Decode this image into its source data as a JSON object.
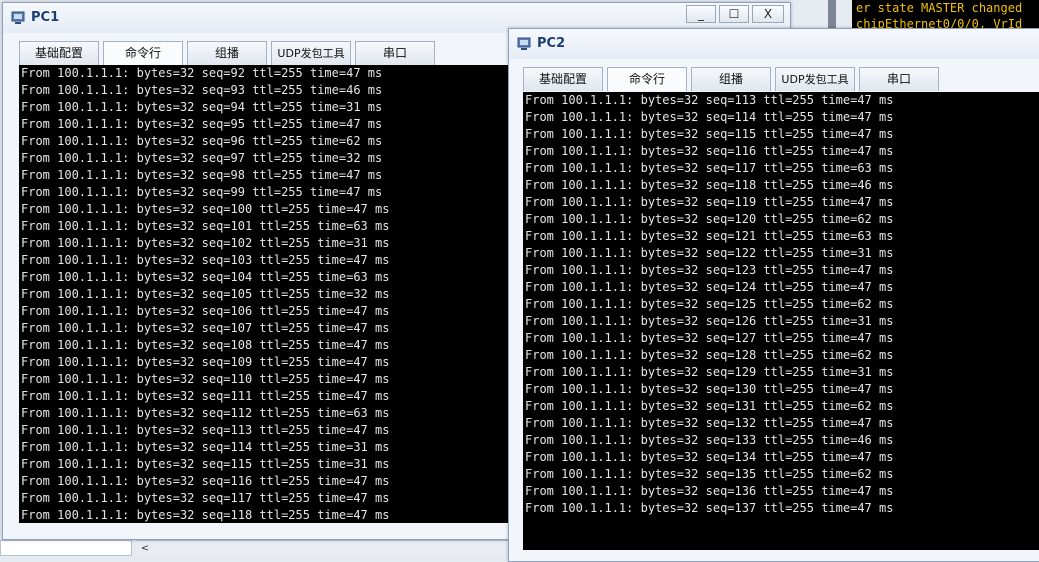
{
  "background": {
    "console_lines": [
      "er state MASTER changed",
      "chipEthernet0/0/0, VrId"
    ]
  },
  "pc1": {
    "title": "PC1",
    "controls": {
      "minimize": "_",
      "maximize": "☐",
      "close": "X"
    },
    "tabs": [
      "基础配置",
      "命令行",
      "组播",
      "UDP发包工具",
      "串口"
    ],
    "active_tab": "命令行",
    "lines": [
      "From 100.1.1.1: bytes=32 seq=92 ttl=255 time=47 ms",
      "From 100.1.1.1: bytes=32 seq=93 ttl=255 time=46 ms",
      "From 100.1.1.1: bytes=32 seq=94 ttl=255 time=31 ms",
      "From 100.1.1.1: bytes=32 seq=95 ttl=255 time=47 ms",
      "From 100.1.1.1: bytes=32 seq=96 ttl=255 time=62 ms",
      "From 100.1.1.1: bytes=32 seq=97 ttl=255 time=32 ms",
      "From 100.1.1.1: bytes=32 seq=98 ttl=255 time=47 ms",
      "From 100.1.1.1: bytes=32 seq=99 ttl=255 time=47 ms",
      "From 100.1.1.1: bytes=32 seq=100 ttl=255 time=47 ms",
      "From 100.1.1.1: bytes=32 seq=101 ttl=255 time=63 ms",
      "From 100.1.1.1: bytes=32 seq=102 ttl=255 time=31 ms",
      "From 100.1.1.1: bytes=32 seq=103 ttl=255 time=47 ms",
      "From 100.1.1.1: bytes=32 seq=104 ttl=255 time=63 ms",
      "From 100.1.1.1: bytes=32 seq=105 ttl=255 time=32 ms",
      "From 100.1.1.1: bytes=32 seq=106 ttl=255 time=47 ms",
      "From 100.1.1.1: bytes=32 seq=107 ttl=255 time=47 ms",
      "From 100.1.1.1: bytes=32 seq=108 ttl=255 time=47 ms",
      "From 100.1.1.1: bytes=32 seq=109 ttl=255 time=47 ms",
      "From 100.1.1.1: bytes=32 seq=110 ttl=255 time=47 ms",
      "From 100.1.1.1: bytes=32 seq=111 ttl=255 time=47 ms",
      "From 100.1.1.1: bytes=32 seq=112 ttl=255 time=63 ms",
      "From 100.1.1.1: bytes=32 seq=113 ttl=255 time=47 ms",
      "From 100.1.1.1: bytes=32 seq=114 ttl=255 time=31 ms",
      "From 100.1.1.1: bytes=32 seq=115 ttl=255 time=31 ms",
      "From 100.1.1.1: bytes=32 seq=116 ttl=255 time=47 ms",
      "From 100.1.1.1: bytes=32 seq=117 ttl=255 time=47 ms",
      "From 100.1.1.1: bytes=32 seq=118 ttl=255 time=47 ms"
    ]
  },
  "pc2": {
    "title": "PC2",
    "tabs": [
      "基础配置",
      "命令行",
      "组播",
      "UDP发包工具",
      "串口"
    ],
    "active_tab": "命令行",
    "lines": [
      "From 100.1.1.1: bytes=32 seq=113 ttl=255 time=47 ms",
      "From 100.1.1.1: bytes=32 seq=114 ttl=255 time=47 ms",
      "From 100.1.1.1: bytes=32 seq=115 ttl=255 time=47 ms",
      "From 100.1.1.1: bytes=32 seq=116 ttl=255 time=47 ms",
      "From 100.1.1.1: bytes=32 seq=117 ttl=255 time=63 ms",
      "From 100.1.1.1: bytes=32 seq=118 ttl=255 time=46 ms",
      "From 100.1.1.1: bytes=32 seq=119 ttl=255 time=47 ms",
      "From 100.1.1.1: bytes=32 seq=120 ttl=255 time=62 ms",
      "From 100.1.1.1: bytes=32 seq=121 ttl=255 time=63 ms",
      "From 100.1.1.1: bytes=32 seq=122 ttl=255 time=31 ms",
      "From 100.1.1.1: bytes=32 seq=123 ttl=255 time=47 ms",
      "From 100.1.1.1: bytes=32 seq=124 ttl=255 time=47 ms",
      "From 100.1.1.1: bytes=32 seq=125 ttl=255 time=62 ms",
      "From 100.1.1.1: bytes=32 seq=126 ttl=255 time=31 ms",
      "From 100.1.1.1: bytes=32 seq=127 ttl=255 time=47 ms",
      "From 100.1.1.1: bytes=32 seq=128 ttl=255 time=62 ms",
      "From 100.1.1.1: bytes=32 seq=129 ttl=255 time=31 ms",
      "From 100.1.1.1: bytes=32 seq=130 ttl=255 time=47 ms",
      "From 100.1.1.1: bytes=32 seq=131 ttl=255 time=62 ms",
      "From 100.1.1.1: bytes=32 seq=132 ttl=255 time=47 ms",
      "From 100.1.1.1: bytes=32 seq=133 ttl=255 time=46 ms",
      "From 100.1.1.1: bytes=32 seq=134 ttl=255 time=47 ms",
      "From 100.1.1.1: bytes=32 seq=135 ttl=255 time=62 ms",
      "From 100.1.1.1: bytes=32 seq=136 ttl=255 time=47 ms",
      "From 100.1.1.1: bytes=32 seq=137 ttl=255 time=47 ms"
    ]
  },
  "scrollbar": {
    "left_arrow": "<"
  },
  "colors": {
    "terminal_bg": "#000000",
    "terminal_fg": "#e6e6e6",
    "console_fg": "#f0c000",
    "title_fg": "#1b3f74"
  }
}
